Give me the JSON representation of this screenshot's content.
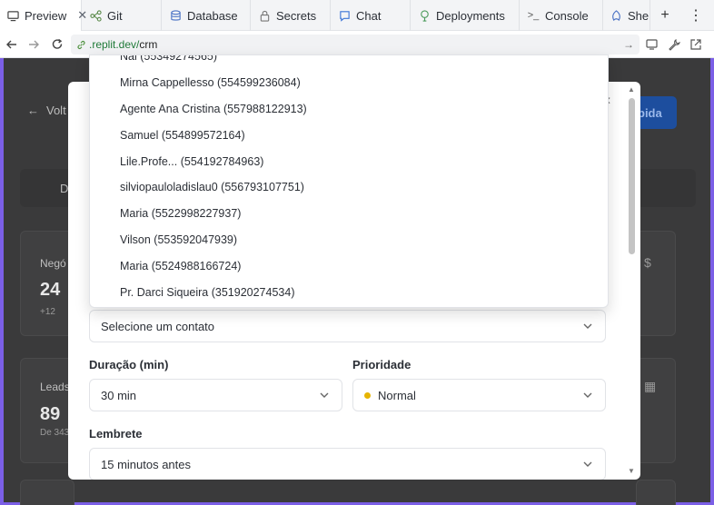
{
  "browser": {
    "tabs": [
      {
        "label": "Preview",
        "icon": "monitor-icon",
        "active": true
      },
      {
        "label": "Git",
        "icon": "git-icon"
      },
      {
        "label": "Database",
        "icon": "database-icon"
      },
      {
        "label": "Secrets",
        "icon": "lock-icon"
      },
      {
        "label": "Chat",
        "icon": "chat-icon"
      },
      {
        "label": "Deployments",
        "icon": "deployments-icon"
      },
      {
        "label": "Console",
        "icon": "console-icon"
      },
      {
        "label": "Shell",
        "icon": "shell-icon"
      }
    ],
    "url_domain": ".replit.dev/",
    "url_path": "crm"
  },
  "background": {
    "back_label": "Volt",
    "primary_button": "pida",
    "tab_label": "D",
    "cards": [
      {
        "label": "Negó",
        "value": "24",
        "sub": "+12"
      },
      {
        "label": "Leads",
        "value": "89",
        "sub": "De 343"
      }
    ]
  },
  "dropdown": {
    "partial_option": "Nai (55349274565)",
    "options": [
      "Mirna Cappellesso (554599236084)",
      "Agente Ana Cristina (557988122913)",
      "Samuel (554899572164)",
      "Lile.Profe... (554192784963)",
      "silviopauloladislau0 (556793107751)",
      "Maria (5522998227937)",
      "Vilson (553592047939)",
      "Maria (5524988166724)",
      "Pr. Darci Siqueira (351920274534)"
    ]
  },
  "form": {
    "contact_placeholder": "Selecione um contato",
    "duration_label": "Duração (min)",
    "duration_value": "30 min",
    "priority_label": "Prioridade",
    "priority_value": "Normal",
    "priority_color": "#e6b400",
    "reminder_label": "Lembrete",
    "reminder_value": "15 minutos antes"
  }
}
